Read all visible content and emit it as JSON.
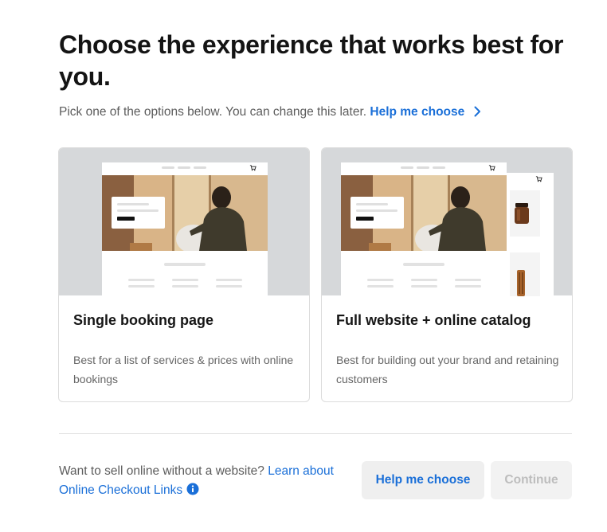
{
  "title": "Choose the experience that works best for you.",
  "subtitle": {
    "text": "Pick one of the options below. You can change this later.",
    "link": "Help me choose",
    "link_icon": "chevron-right-icon"
  },
  "options": [
    {
      "title": "Single booking page",
      "description": "Best for a list of services & prices with online bookings",
      "preview": "single-page-site-preview"
    },
    {
      "title": "Full website + online catalog",
      "description": "Best for building out your brand and retaining customers",
      "preview": "website-and-catalog-preview"
    }
  ],
  "footer": {
    "text": "Want to sell online without a website?",
    "link": "Learn about Online Checkout Links",
    "link_icon": "info-icon",
    "help_button": "Help me choose",
    "continue_button": "Continue",
    "continue_disabled": true
  },
  "colors": {
    "accent": "#1a6fd8",
    "preview_background": "#d6d8da",
    "disabled_text": "#bdbdbd"
  }
}
